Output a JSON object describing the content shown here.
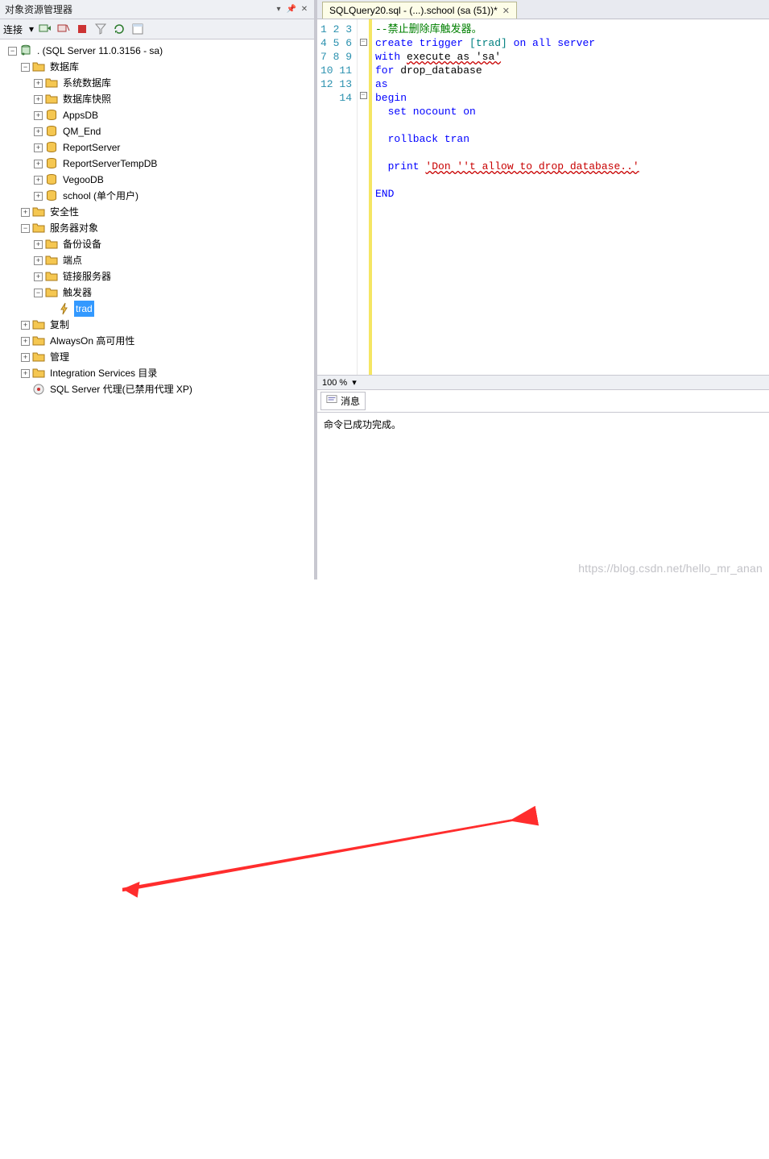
{
  "panel": {
    "title": "对象资源管理器",
    "connect_label": "连接"
  },
  "tree": {
    "root": ". (SQL Server 11.0.3156 - sa)",
    "db_root": "数据库",
    "db_children": [
      "系统数据库",
      "数据库快照",
      "AppsDB",
      "QM_End",
      "ReportServer",
      "ReportServerTempDB",
      "VegooDB"
    ],
    "school": "school (单个用户)",
    "security": "安全性",
    "server_objects": "服务器对象",
    "so_children": [
      "备份设备",
      "端点",
      "链接服务器",
      "触发器"
    ],
    "trigger_prefix": "  ",
    "trigger_name": "trad",
    "replication": "复制",
    "alwayson": "AlwaysOn 高可用性",
    "management": "管理",
    "integration": "Integration Services 目录",
    "agent": "SQL Server 代理(已禁用代理 XP)"
  },
  "tab": {
    "label": "SQLQuery20.sql - (...).school (sa (51))*"
  },
  "code_lines": [
    {
      "n": 1,
      "segs": [
        {
          "t": "--禁止删除库触发器。",
          "c": "c-green"
        }
      ]
    },
    {
      "n": 2,
      "segs": [
        {
          "t": "create trigger",
          "c": "c-blue"
        },
        {
          "t": " [trad] ",
          "c": "c-teal"
        },
        {
          "t": "on all server",
          "c": "c-blue"
        }
      ],
      "fold": "minus"
    },
    {
      "n": 3,
      "segs": [
        {
          "t": "with",
          "c": "c-blue"
        },
        {
          "t": " ",
          "c": "c-black"
        },
        {
          "t": "execute as 'sa'",
          "c": "squiggle c-black"
        }
      ]
    },
    {
      "n": 4,
      "segs": [
        {
          "t": "for",
          "c": "c-blue"
        },
        {
          "t": " drop_database",
          "c": "c-black"
        }
      ]
    },
    {
      "n": 5,
      "segs": [
        {
          "t": "as",
          "c": "c-blue"
        }
      ]
    },
    {
      "n": 6,
      "segs": [
        {
          "t": "begin",
          "c": "c-blue"
        }
      ],
      "fold": "minus"
    },
    {
      "n": 7,
      "segs": [
        {
          "t": "  set nocount on",
          "c": "c-blue"
        }
      ]
    },
    {
      "n": 8,
      "segs": [
        {
          "t": " ",
          "c": "c-black"
        }
      ]
    },
    {
      "n": 9,
      "segs": [
        {
          "t": "  rollback tran",
          "c": "c-blue"
        }
      ]
    },
    {
      "n": 10,
      "segs": [
        {
          "t": " ",
          "c": "c-black"
        }
      ]
    },
    {
      "n": 11,
      "segs": [
        {
          "t": "  print",
          "c": "c-blue"
        },
        {
          "t": " ",
          "c": "c-black"
        },
        {
          "t": "'Don ''t allow to drop database..'",
          "c": "c-red squiggle"
        }
      ]
    },
    {
      "n": 12,
      "segs": [
        {
          "t": " ",
          "c": "c-black"
        }
      ]
    },
    {
      "n": 13,
      "segs": [
        {
          "t": "END",
          "c": "c-blue"
        }
      ]
    },
    {
      "n": 14,
      "segs": [
        {
          "t": "",
          "c": "c-black"
        }
      ]
    }
  ],
  "zoom": "100 %",
  "results": {
    "tab": "消息",
    "msg": "命令已成功完成。"
  },
  "watermark": "https://blog.csdn.net/hello_mr_anan"
}
